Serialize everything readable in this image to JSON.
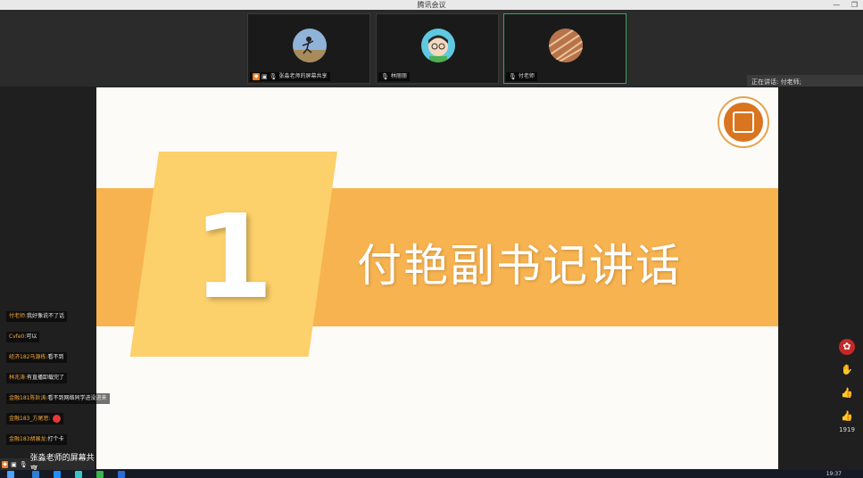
{
  "window": {
    "title": "腾讯会议"
  },
  "participants": [
    {
      "name": "张淼老师的屏幕共享",
      "active": false
    },
    {
      "name": "林丽丽",
      "active": false
    },
    {
      "name": "付老师",
      "active": true
    }
  ],
  "speaking": {
    "label": "正在讲话: 付老师;"
  },
  "slide": {
    "number": "1",
    "title": "付艳副书记讲话"
  },
  "chat": [
    {
      "user": "付老师:",
      "text": "我好像说不了话"
    },
    {
      "user": "Cvfe0:",
      "text": "可以"
    },
    {
      "user": "经济182马源栋:",
      "text": "看不到"
    },
    {
      "user": "林兆涛:",
      "text": "有直播卸载完了"
    },
    {
      "user": "金融181陈鈥涛:",
      "text": "看不到网络同学进没进来"
    },
    {
      "user": "金融183_方尾思:",
      "text": ""
    },
    {
      "user": "金融183胡展龙:",
      "text": "打个卡"
    }
  ],
  "share_label": {
    "text": "张淼老师的屏幕共享"
  },
  "reactions": {
    "count": "1919"
  },
  "taskbar": {
    "time": "19:37"
  },
  "colors": {
    "band": "#f7b34f",
    "block": "#fcd06a",
    "active_border": "#3da35d",
    "accent": "#f07b22"
  }
}
